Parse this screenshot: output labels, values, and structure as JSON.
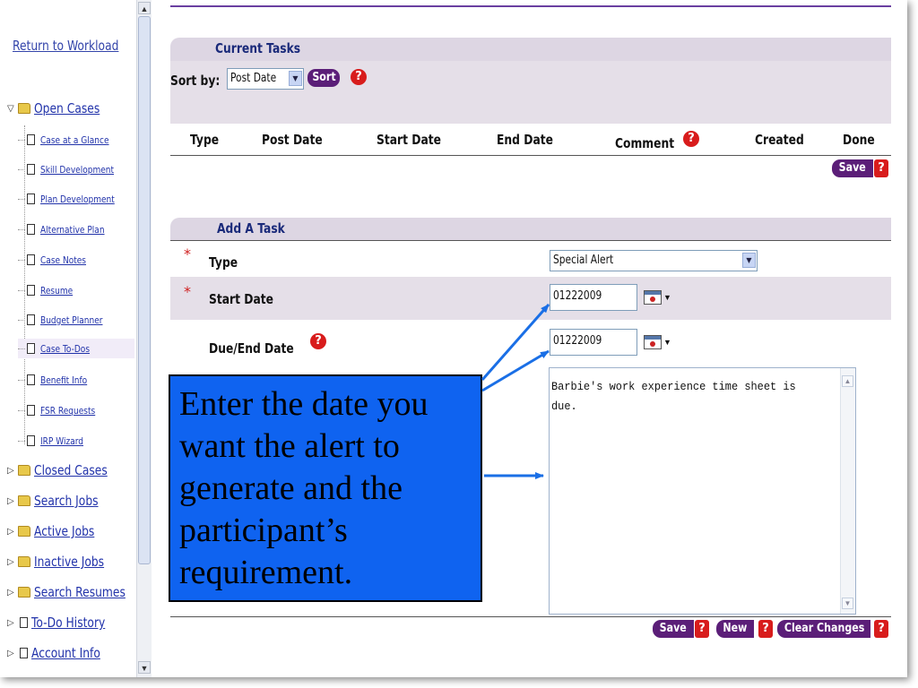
{
  "sidebar": {
    "return_link": "Return to Workload",
    "open_cases": "Open Cases",
    "sub_items": [
      "Case at a Glance",
      "Skill Development",
      "Plan Development",
      "Alternative Plan",
      "Case Notes",
      "Resume",
      "Budget Planner",
      "Case To-Dos",
      "Benefit Info",
      "FSR Requests",
      "IRP Wizard"
    ],
    "active_item": "Case To-Dos",
    "bottom_items": [
      {
        "label": "Closed Cases",
        "icon": "folder-icon"
      },
      {
        "label": "Search Jobs",
        "icon": "folder-icon"
      },
      {
        "label": "Active Jobs",
        "icon": "folder-icon"
      },
      {
        "label": "Inactive Jobs",
        "icon": "folder-icon"
      },
      {
        "label": "Search Resumes",
        "icon": "folder-icon"
      },
      {
        "label": "To-Do History",
        "icon": "document-icon"
      },
      {
        "label": "Account Info",
        "icon": "document-icon"
      }
    ]
  },
  "current_tasks": {
    "title": "Current Tasks",
    "sort_label": "Sort by:",
    "sort_value": "Post Date",
    "sort_button": "Sort",
    "help": "?",
    "columns": [
      "Type",
      "Post Date",
      "Start Date",
      "End Date",
      "Comment",
      "Created",
      "Done"
    ],
    "save_button": "Save"
  },
  "add_task": {
    "title": "Add A Task",
    "required_mark": "*",
    "type_label": "Type",
    "type_value": "Special Alert",
    "start_date_label": "Start Date",
    "start_date_value": "01222009",
    "due_date_label": "Due/End Date",
    "due_date_value": "01222009",
    "comment_value": "Barbie's work experience time sheet is due.",
    "save_button": "Save",
    "new_button": "New",
    "clear_button": "Clear Changes",
    "help": "?"
  },
  "callout": {
    "text": "Enter the date you want the alert to generate and the participant’s requirement."
  },
  "colors": {
    "accent": "#5b1e78",
    "panel": "#e5dfe8",
    "link": "#2233aa",
    "callout": "#0f63f0",
    "help": "#d81c1c",
    "arrow": "#1a6fe6"
  }
}
